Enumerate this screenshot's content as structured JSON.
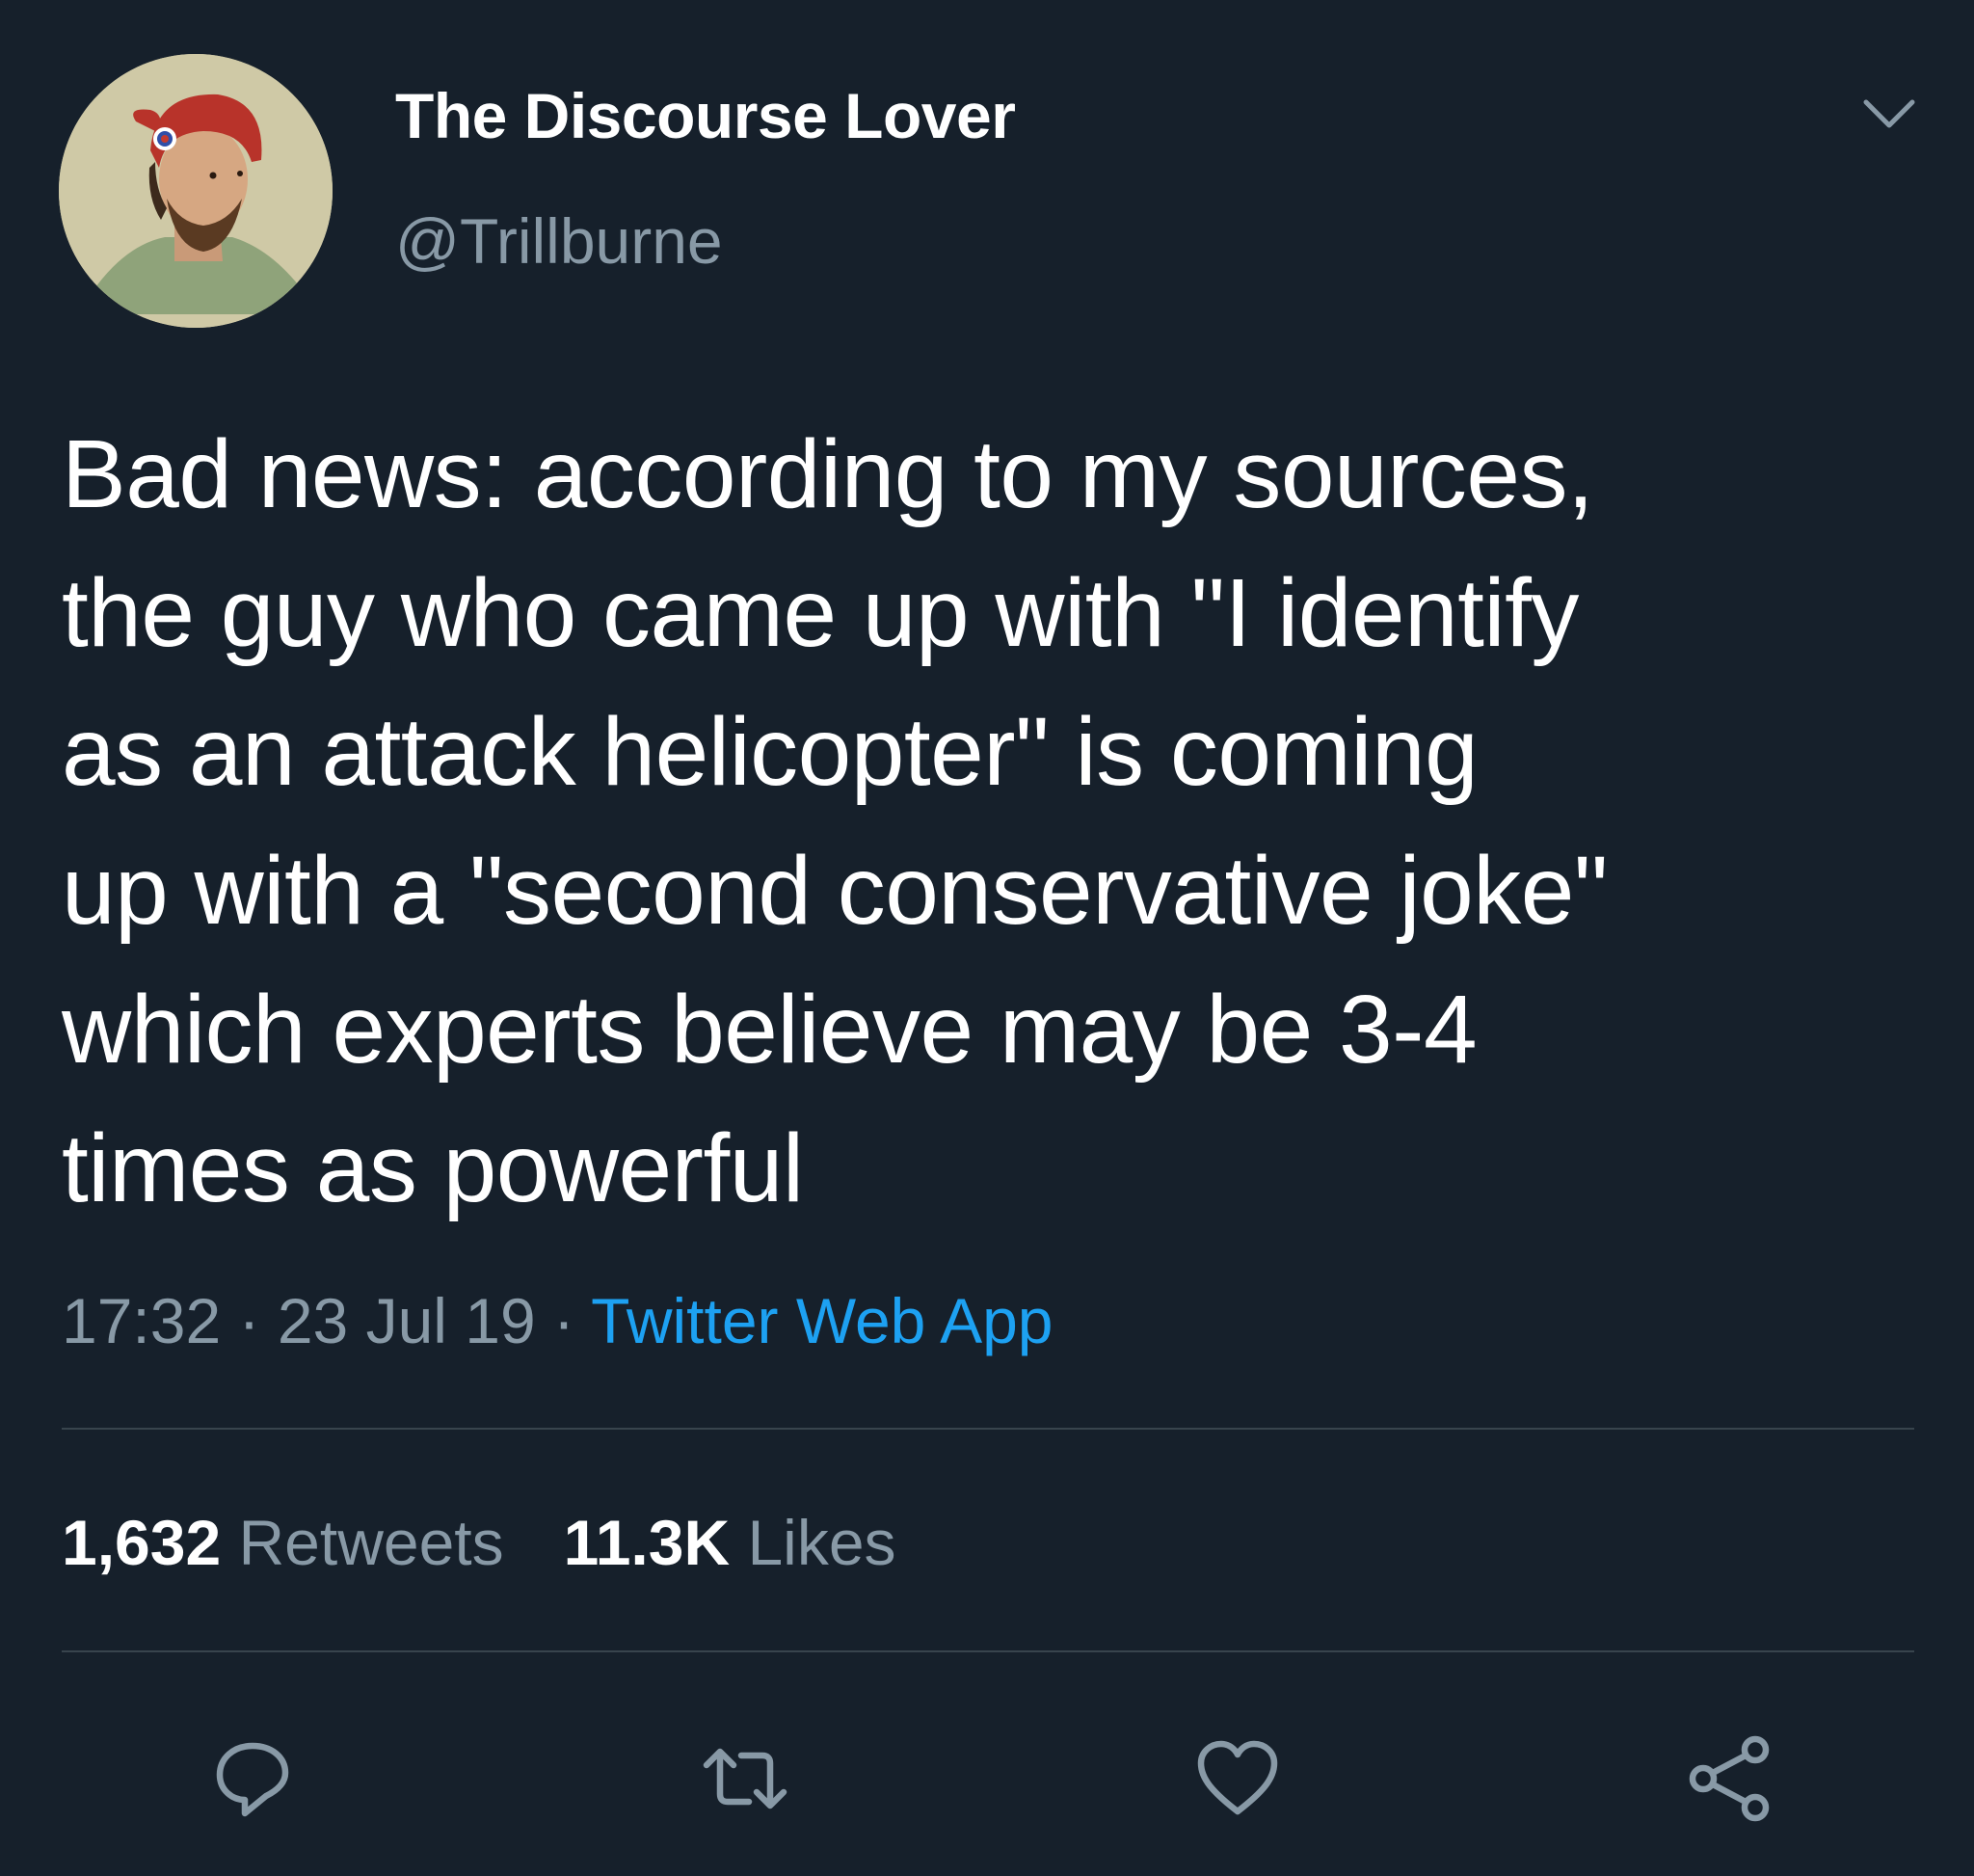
{
  "tweet": {
    "author": {
      "display_name": "The Discourse Lover",
      "handle": "@Trillburne"
    },
    "text_lines": [
      "Bad news: according to my sources,",
      "the guy who came up with \"I identify",
      "as an attack helicopter\" is coming",
      "up with a \"second conservative joke\"",
      "which experts believe may be 3-4",
      "times as powerful"
    ],
    "meta": {
      "time": "17:32",
      "separator": " · ",
      "date": "23 Jul 19",
      "source": "Twitter Web App"
    },
    "stats": {
      "retweets_count": "1,632",
      "retweets_label": "Retweets",
      "likes_count": "11.3K",
      "likes_label": "Likes"
    },
    "actions": {
      "reply": "reply-icon",
      "retweet": "retweet-icon",
      "like": "heart-icon",
      "share": "share-icon"
    }
  },
  "colors": {
    "background": "#16202b",
    "text": "#ffffff",
    "muted": "#8899a6",
    "link": "#1da1f2",
    "divider": "#38444d"
  }
}
